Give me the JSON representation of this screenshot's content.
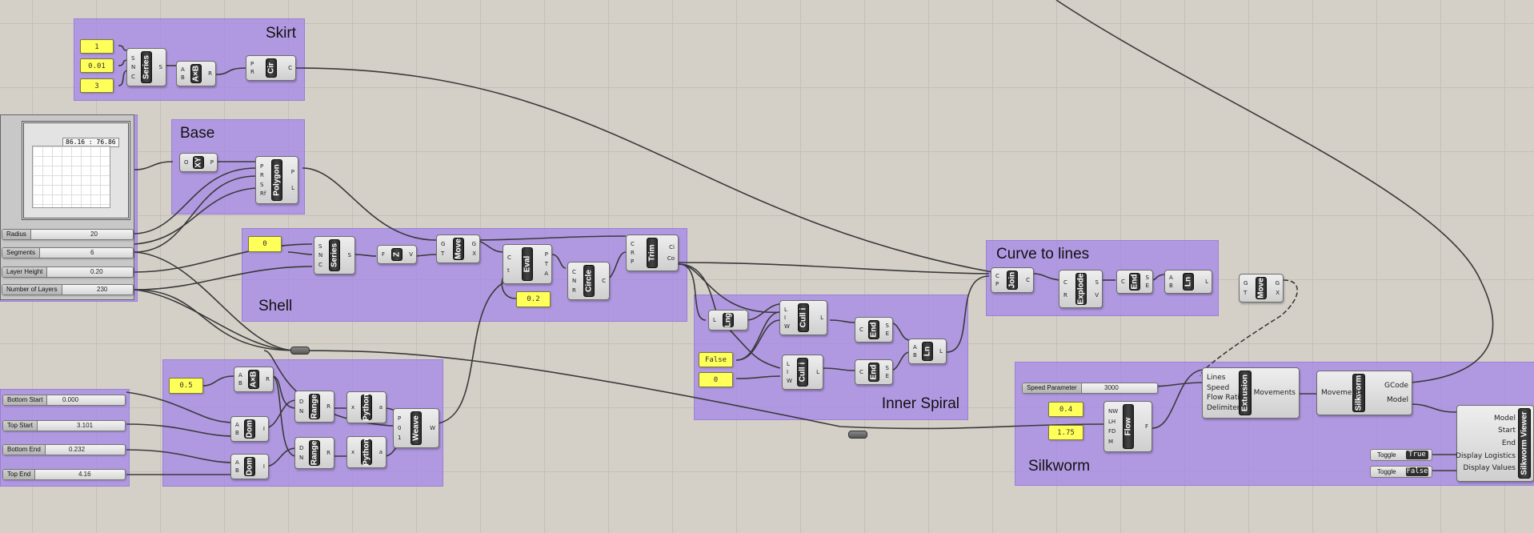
{
  "groups": {
    "skirt": "Skirt",
    "base": "Base",
    "shell": "Shell",
    "curve_to_lines": "Curve to lines",
    "inner_spiral": "Inner Spiral",
    "silkworm": "Silkworm"
  },
  "panels": {
    "skirt_start": "1",
    "skirt_step": "0.01",
    "skirt_count": "3",
    "shell_start": "0",
    "eval_param": "0.2",
    "weave_factor": "0.5",
    "spiral_flag": "False",
    "spiral_index": "0",
    "flow_nw": "0.4",
    "flow_lh": "1.75"
  },
  "graph_mapper": {
    "coords": "86.16 : 76.86"
  },
  "sliders": {
    "radius": {
      "name": "Radius",
      "value": "20"
    },
    "segments": {
      "name": "Segments",
      "value": "6"
    },
    "layer_height": {
      "name": "Layer Height",
      "value": "0.20"
    },
    "number_of_layers": {
      "name": "Number of Layers",
      "value": "230"
    },
    "bottom_start": {
      "name": "Bottom Start",
      "value": "0.000"
    },
    "top_start": {
      "name": "Top Start",
      "value": "3.101"
    },
    "bottom_end": {
      "name": "Bottom End",
      "value": "0.232"
    },
    "top_end": {
      "name": "Top End",
      "value": "4.16"
    },
    "speed_parameter": {
      "name": "Speed Parameter",
      "value": "3000"
    }
  },
  "toggles": {
    "display_logistics": {
      "name": "Toggle",
      "value": "True"
    },
    "display_values": {
      "name": "Toggle",
      "value": "False"
    }
  },
  "components": {
    "series_skirt": {
      "name": "Series",
      "inputs": [
        "S",
        "N",
        "C"
      ],
      "outputs": [
        "S"
      ]
    },
    "mult_skirt": {
      "name": "A×B",
      "inputs": [
        "A",
        "B"
      ],
      "outputs": [
        "R"
      ]
    },
    "circle_skirt": {
      "name": "Cir",
      "inputs": [
        "P",
        "R"
      ],
      "outputs": [
        "C"
      ]
    },
    "xy_plane": {
      "name": "XY",
      "inputs": [
        "O"
      ],
      "outputs": [
        "P"
      ]
    },
    "polygon": {
      "name": "Polygon",
      "inputs": [
        "P",
        "R",
        "S",
        "Rf"
      ],
      "outputs": [
        "P",
        "L"
      ]
    },
    "series_shell": {
      "name": "Series",
      "inputs": [
        "S",
        "N",
        "C"
      ],
      "outputs": [
        "S"
      ]
    },
    "unit_z": {
      "name": "Z",
      "inputs": [
        "F"
      ],
      "outputs": [
        "V"
      ]
    },
    "move_shell": {
      "name": "Move",
      "inputs": [
        "G",
        "T"
      ],
      "outputs": [
        "G",
        "X"
      ]
    },
    "eval": {
      "name": "Eval",
      "inputs": [
        "C",
        "t"
      ],
      "outputs": [
        "P",
        "T",
        "A"
      ]
    },
    "circle_shell": {
      "name": "Circle",
      "inputs": [
        "C",
        "N",
        "R"
      ],
      "outputs": [
        "C"
      ]
    },
    "trim": {
      "name": "Trim",
      "inputs": [
        "C",
        "R",
        "P"
      ],
      "outputs": [
        "Ci",
        "Co"
      ]
    },
    "mult_weave": {
      "name": "A×B",
      "inputs": [
        "A",
        "B"
      ],
      "outputs": [
        "R"
      ]
    },
    "dom_1": {
      "name": "Dom",
      "inputs": [
        "A",
        "B"
      ],
      "outputs": [
        "I"
      ]
    },
    "dom_2": {
      "name": "Dom",
      "inputs": [
        "A",
        "B"
      ],
      "outputs": [
        "I"
      ]
    },
    "range_1": {
      "name": "Range",
      "inputs": [
        "D",
        "N"
      ],
      "outputs": [
        "R"
      ]
    },
    "range_2": {
      "name": "Range",
      "inputs": [
        "D",
        "N"
      ],
      "outputs": [
        "R"
      ]
    },
    "python_1": {
      "name": "Python",
      "inputs": [
        "x"
      ],
      "outputs": [
        "a"
      ]
    },
    "python_2": {
      "name": "Python",
      "inputs": [
        "x"
      ],
      "outputs": [
        "a"
      ]
    },
    "weave": {
      "name": "Weave",
      "inputs": [
        "P",
        "0",
        "1"
      ],
      "outputs": [
        "W"
      ]
    },
    "lng": {
      "name": "Lng",
      "inputs": [
        "L"
      ],
      "outputs": [
        ""
      ]
    },
    "cull_top": {
      "name": "Cull i",
      "inputs": [
        "L",
        "I",
        "W"
      ],
      "outputs": [
        "L"
      ]
    },
    "cull_bottom": {
      "name": "Cull i",
      "inputs": [
        "L",
        "I",
        "W"
      ],
      "outputs": [
        "L"
      ]
    },
    "end_top": {
      "name": "End",
      "inputs": [
        "C"
      ],
      "outputs": [
        "S",
        "E"
      ]
    },
    "end_bottom": {
      "name": "End",
      "inputs": [
        "C"
      ],
      "outputs": [
        "S",
        "E"
      ]
    },
    "line_spiral": {
      "name": "Ln",
      "inputs": [
        "A",
        "B"
      ],
      "outputs": [
        "L"
      ]
    },
    "join": {
      "name": "Join",
      "inputs": [
        "C",
        "P"
      ],
      "outputs": [
        "C"
      ]
    },
    "explode": {
      "name": "Explode",
      "inputs": [
        "C",
        "R"
      ],
      "outputs": [
        "S",
        "V"
      ]
    },
    "end_lines": {
      "name": "End",
      "inputs": [
        "C"
      ],
      "outputs": [
        "S",
        "E"
      ]
    },
    "line_lines": {
      "name": "Ln",
      "inputs": [
        "A",
        "B"
      ],
      "outputs": [
        "L"
      ]
    },
    "move_lines": {
      "name": "Move",
      "inputs": [
        "G",
        "T"
      ],
      "outputs": [
        "G",
        "X"
      ]
    },
    "flow": {
      "name": "Flow",
      "inputs": [
        "NW",
        "LH",
        "FD",
        "M"
      ],
      "outputs": [
        "F"
      ]
    },
    "extrusion": {
      "name": "Extrusion",
      "inputs": [
        "Lines",
        "Speed",
        "Flow Ratio",
        "Delimiter"
      ],
      "outputs": [
        "Movements"
      ]
    },
    "silkworm": {
      "name": "Silkworm",
      "inputs": [
        "Movements"
      ],
      "outputs": [
        "GCode",
        "Model"
      ]
    },
    "viewer": {
      "name": "Silkworm Viewer",
      "inputs": [
        "Model",
        "Start",
        "End",
        "Display Logistics",
        "Display Values"
      ],
      "outputs": []
    }
  },
  "colors": {
    "canvas": "#d4d0c8",
    "group": "#a587eb",
    "panel": "#ffff59",
    "wire": "#3a3a3a"
  }
}
